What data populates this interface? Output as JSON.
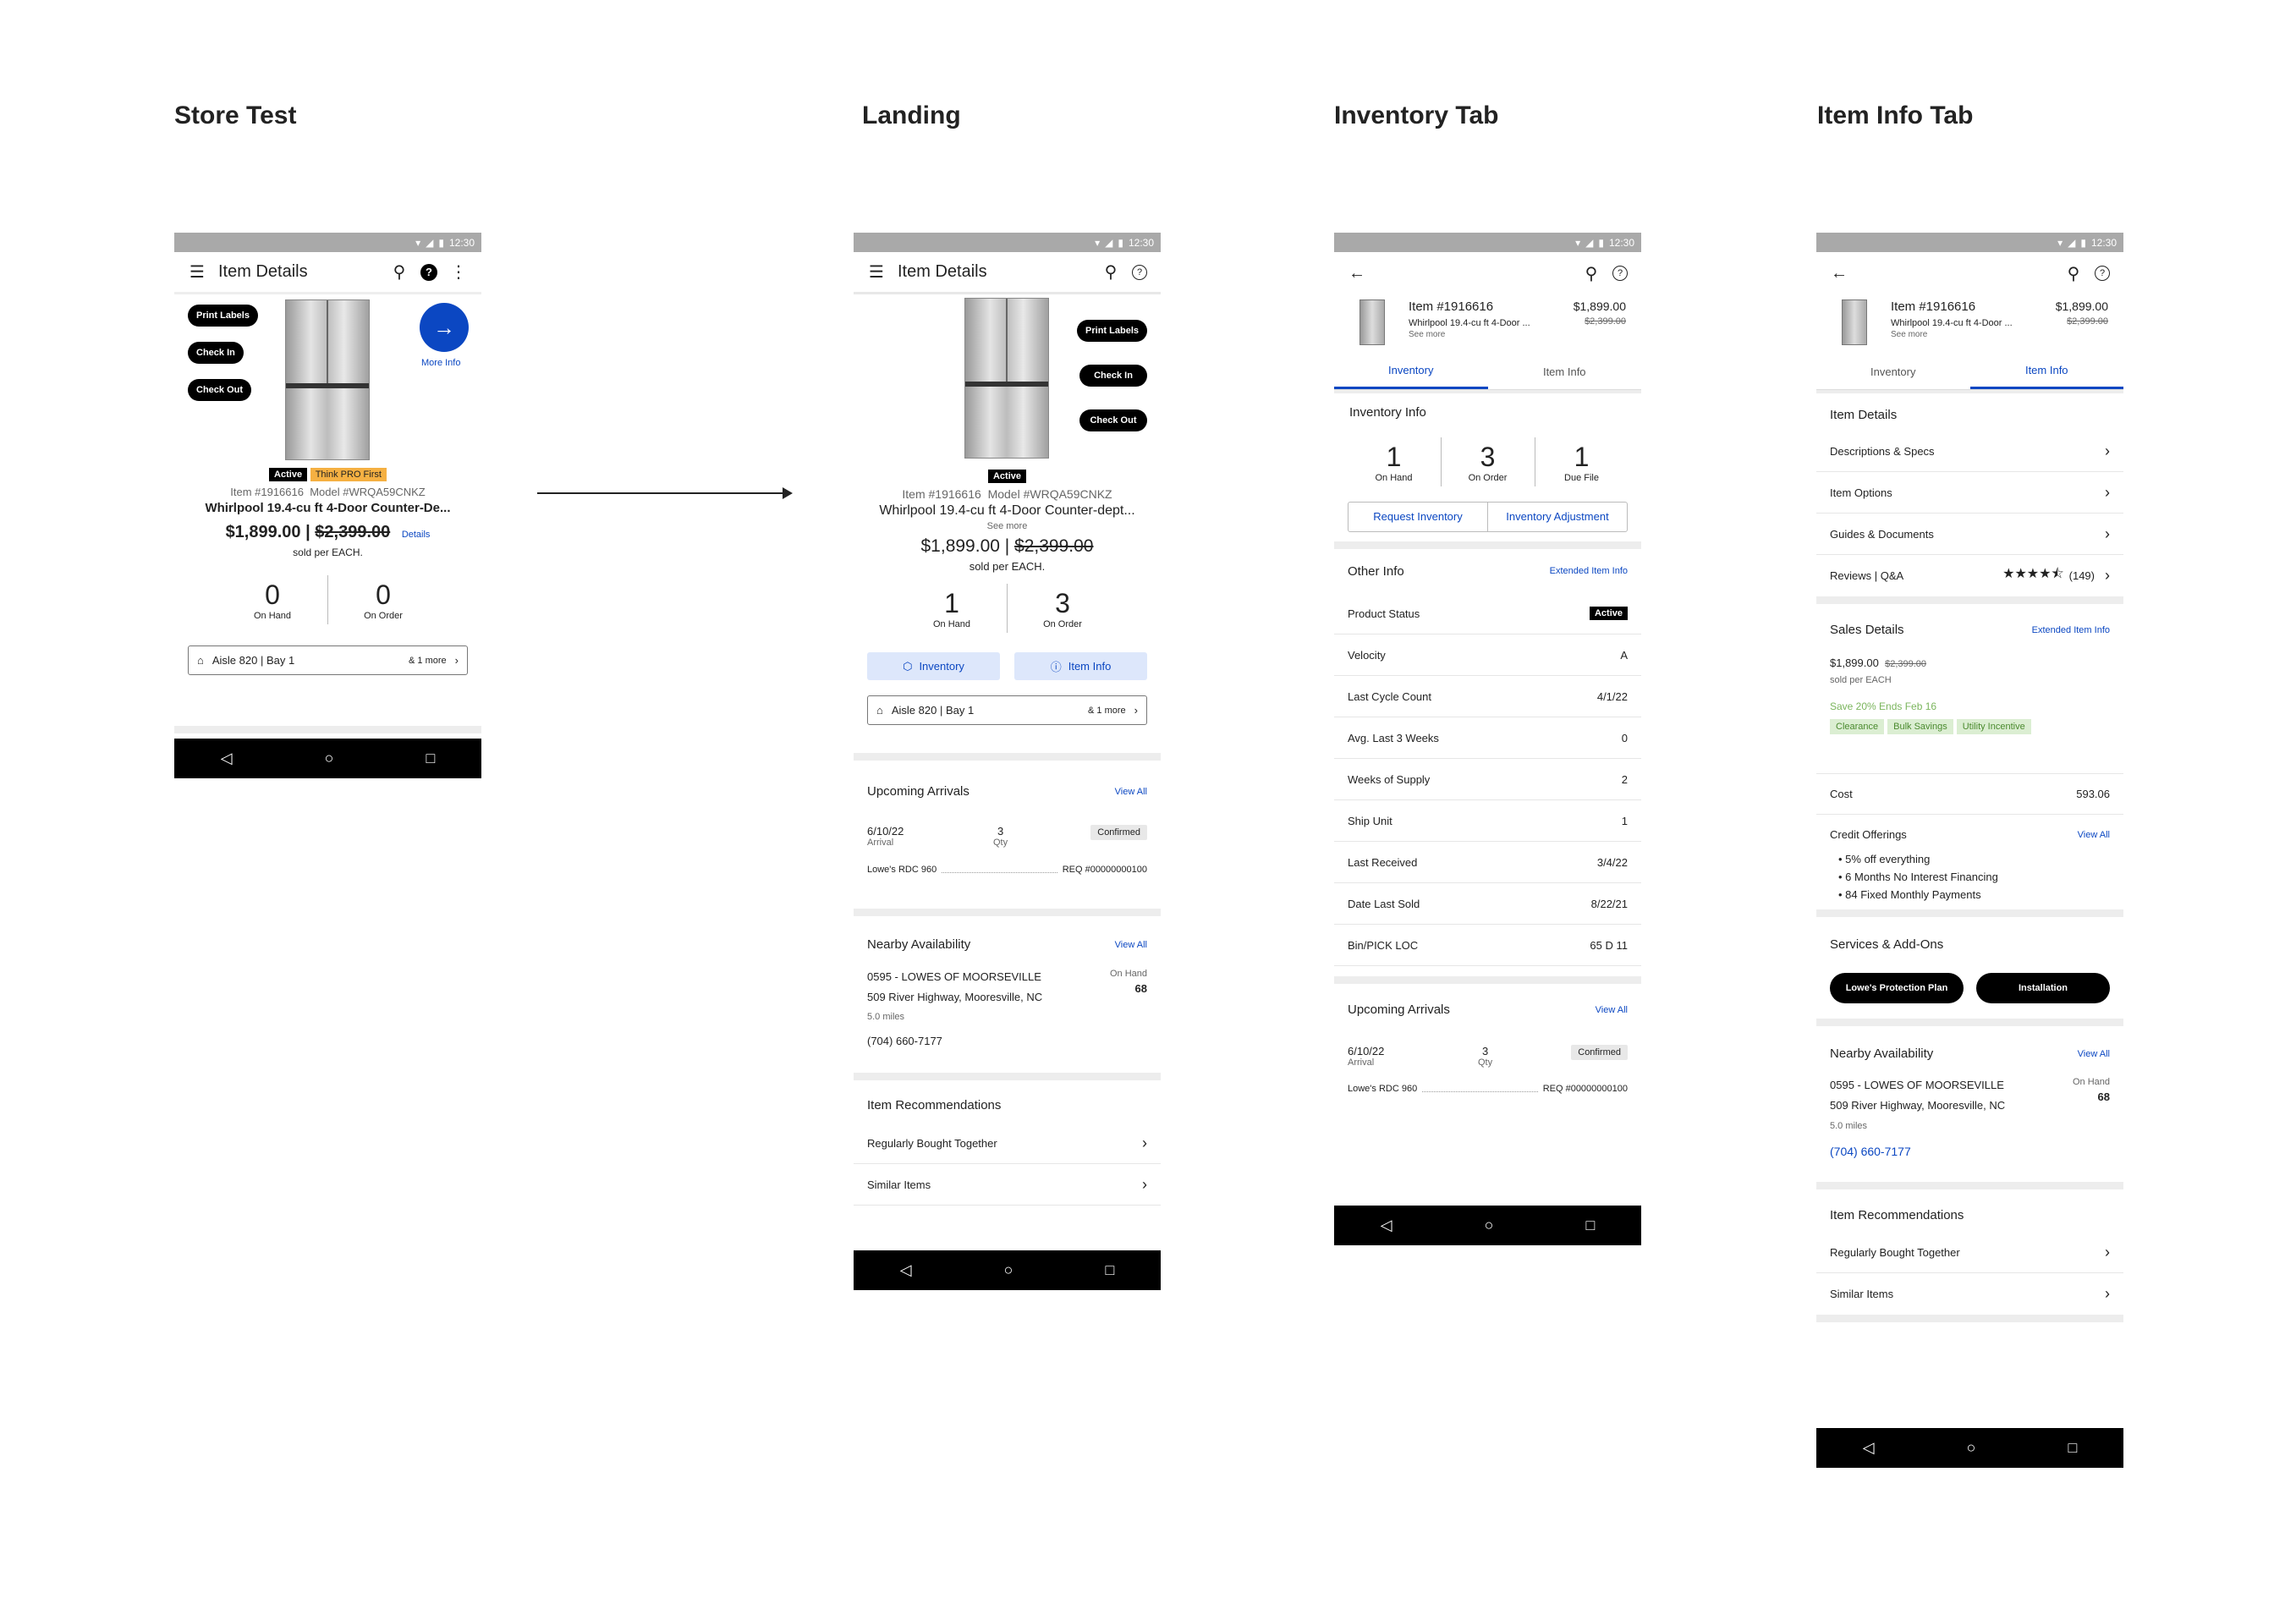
{
  "sections": {
    "store_test": "Store Test",
    "landing": "Landing",
    "inventory_tab": "Inventory Tab",
    "item_info_tab": "Item Info Tab"
  },
  "status_time": "12:30",
  "item": {
    "number": "Item #1916616",
    "model": "Model #WRQA59CNKZ",
    "name_store": "Whirlpool 19.4-cu ft 4-Door Counter-De...",
    "name_landing": "Whirlpool 19.4-cu ft 4-Door Counter-dept...",
    "name_short": "Whirlpool 19.4-cu ft 4-Door ...",
    "see_more": "See more",
    "price": "$1,899.00",
    "was_price": "$2,399.00",
    "sold_per": "sold per EACH.",
    "sold_per_info": "sold per EACH"
  },
  "labels": {
    "item_details": "Item Details",
    "print_labels": "Print Labels",
    "check_in": "Check In",
    "check_out": "Check Out",
    "more_info": "More Info",
    "active": "Active",
    "think_pro": "Think PRO First",
    "details": "Details",
    "on_hand": "On Hand",
    "on_order": "On Order",
    "due_file": "Due File",
    "aisle": "Aisle 820 | Bay 1",
    "more_locations": "& 1 more",
    "inventory": "Inventory",
    "item_info": "Item Info",
    "upcoming_arrivals": "Upcoming Arrivals",
    "view_all": "View All",
    "arrival_date": "6/10/22",
    "arrival": "Arrival",
    "arrival_qty": "3",
    "qty": "Qty",
    "confirmed": "Confirmed",
    "rdc": "Lowe's RDC 960",
    "req": "REQ #00000000100",
    "nearby": "Nearby Availability",
    "store_name": "0595 - LOWES OF MOORSEVILLE",
    "store_addr": "509 River Highway, Mooresville, NC",
    "store_miles": "5.0 miles",
    "store_phone": "(704) 660-7177",
    "store_on_hand": "68",
    "recommendations": "Item Recommendations",
    "bought_together": "Regularly Bought Together",
    "similar": "Similar Items",
    "inventory_info": "Inventory Info",
    "request_inventory": "Request Inventory",
    "inventory_adjustment": "Inventory Adjustment",
    "other_info": "Other Info",
    "extended_item_info": "Extended Item Info"
  },
  "store_counts": {
    "on_hand": "0",
    "on_order": "0"
  },
  "landing_counts": {
    "on_hand": "1",
    "on_order": "3"
  },
  "inventory_counts": {
    "on_hand": "1",
    "on_order": "3",
    "due_file": "1"
  },
  "other_info_rows": [
    {
      "label": "Product Status",
      "value": "Active"
    },
    {
      "label": "Velocity",
      "value": "A"
    },
    {
      "label": "Last Cycle Count",
      "value": "4/1/22"
    },
    {
      "label": "Avg. Last 3 Weeks",
      "value": "0"
    },
    {
      "label": "Weeks of Supply",
      "value": "2"
    },
    {
      "label": "Ship Unit",
      "value": "1"
    },
    {
      "label": "Last Received",
      "value": "3/4/22"
    },
    {
      "label": "Date Last Sold",
      "value": "8/22/21"
    },
    {
      "label": "Bin/PICK LOC",
      "value": "65 D 11"
    }
  ],
  "item_info": {
    "item_details_rows": [
      "Descriptions & Specs",
      "Item Options",
      "Guides & Documents",
      "Reviews | Q&A"
    ],
    "reviews_count": "(149)",
    "rating": 4.5,
    "sales_details": "Sales Details",
    "save_text": "Save 20% Ends Feb 16",
    "tags": [
      "Clearance",
      "Bulk Savings",
      "Utility Incentive"
    ],
    "cost_label": "Cost",
    "cost_value": "593.06",
    "credit_offerings": "Credit Offerings",
    "credit_items": [
      "5% off everything",
      "6 Months No Interest Financing",
      "84 Fixed Monthly Payments"
    ],
    "services": "Services & Add-Ons",
    "protection_plan": "Lowe's Protection Plan",
    "installation": "Installation"
  },
  "colors": {
    "accent": "#0b47c2",
    "pro_badge": "#f5b042",
    "green_tag": "#dbeed2"
  }
}
